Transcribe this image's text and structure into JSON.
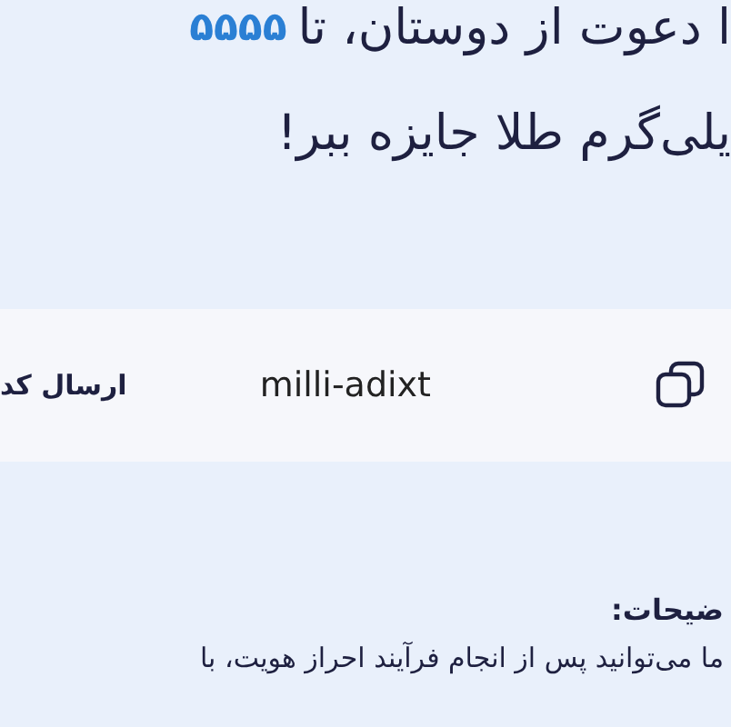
{
  "headline": {
    "lines": [
      "ا دعوت از دوستان، تا",
      "یلی‌گرم طلا جایزه ببر!"
    ],
    "amount": "۵۵۵۵"
  },
  "code_card": {
    "code": "milli-adixt",
    "send_button": "ارسال کد"
  },
  "notes": {
    "heading": "ضیحات:",
    "text": "ما می‌توانید پس از انجام فرآیند احراز هویت، با"
  }
}
